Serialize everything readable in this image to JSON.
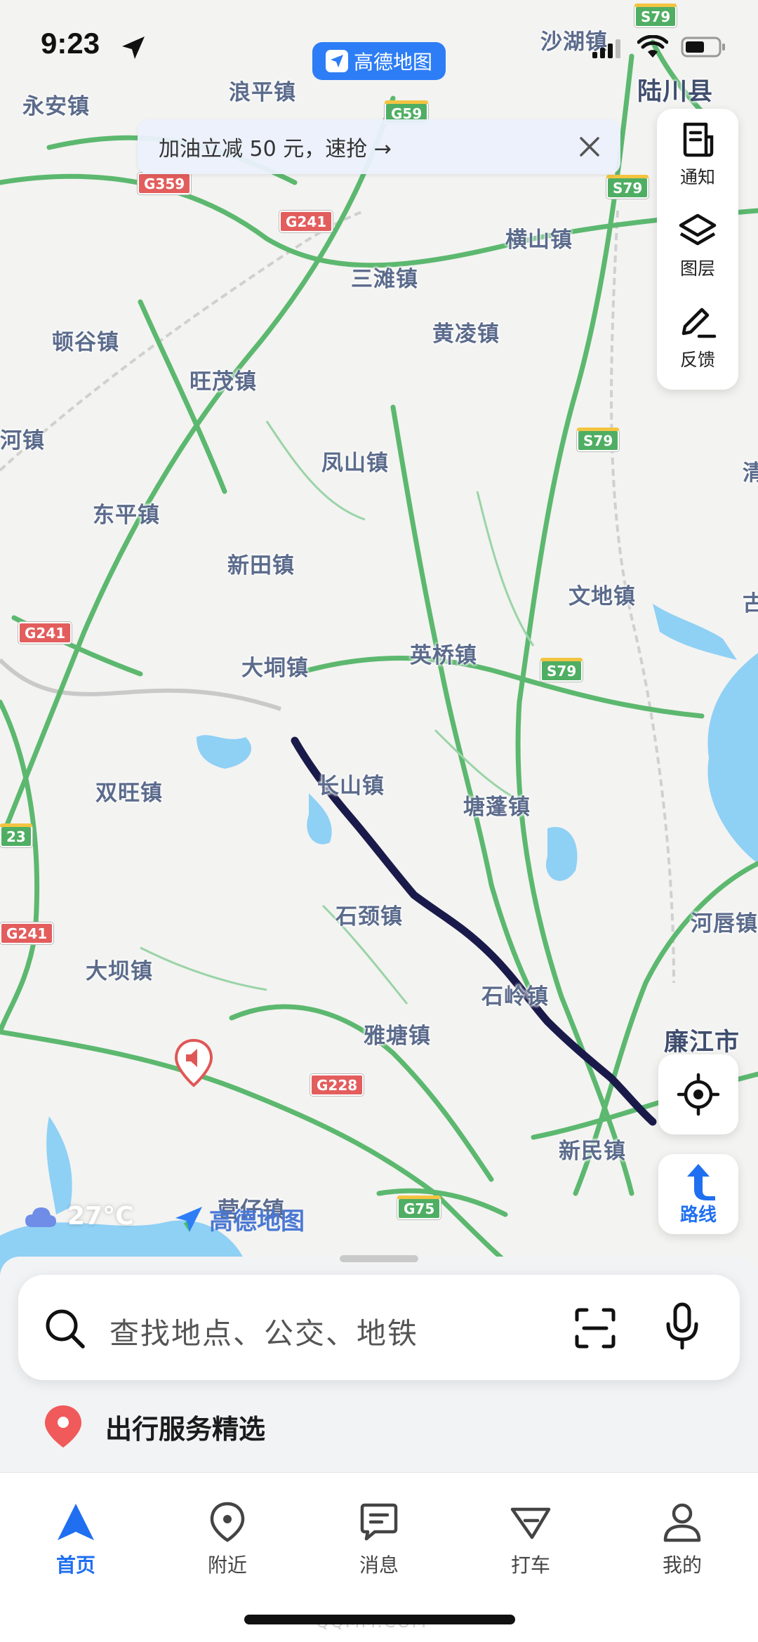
{
  "status_bar": {
    "time": "9:23"
  },
  "app_pill": {
    "label": "高德地图"
  },
  "promo": {
    "text": "加油立减 50 元，速抢 →"
  },
  "side_panel": {
    "items": [
      {
        "label": "通知"
      },
      {
        "label": "图层"
      },
      {
        "label": "反馈"
      }
    ]
  },
  "map": {
    "places": [
      {
        "name": "沙湖镇"
      },
      {
        "name": "陆川县"
      },
      {
        "name": "永安镇"
      },
      {
        "name": "浪平镇"
      },
      {
        "name": "横山镇"
      },
      {
        "name": "三滩镇"
      },
      {
        "name": "顿谷镇"
      },
      {
        "name": "黄凌镇"
      },
      {
        "name": "旺茂镇"
      },
      {
        "name": "河镇"
      },
      {
        "name": "凤山镇"
      },
      {
        "name": "东平镇"
      },
      {
        "name": "新田镇"
      },
      {
        "name": "文地镇"
      },
      {
        "name": "大垌镇"
      },
      {
        "name": "英桥镇"
      },
      {
        "name": "长山镇"
      },
      {
        "name": "双旺镇"
      },
      {
        "name": "塘蓬镇"
      },
      {
        "name": "石颈镇"
      },
      {
        "name": "河唇镇"
      },
      {
        "name": "大坝镇"
      },
      {
        "name": "石岭镇"
      },
      {
        "name": "雅塘镇"
      },
      {
        "name": "廉江市"
      },
      {
        "name": "新民镇"
      },
      {
        "name": "营仔镇"
      },
      {
        "name": "清"
      },
      {
        "name": "古"
      }
    ],
    "shields": [
      {
        "code": "S79"
      },
      {
        "code": "G59"
      },
      {
        "code": "G359"
      },
      {
        "code": "S79"
      },
      {
        "code": "G241"
      },
      {
        "code": "S79"
      },
      {
        "code": "G241"
      },
      {
        "code": "S79"
      },
      {
        "code": "23"
      },
      {
        "code": "G241"
      },
      {
        "code": "G228"
      },
      {
        "code": "G75"
      }
    ]
  },
  "weather": {
    "temp": "27°C"
  },
  "watermark": {
    "text": "高德地图"
  },
  "route_button": {
    "label": "路线"
  },
  "search": {
    "placeholder": "查找地点、公交、地铁"
  },
  "services": {
    "title": "出行服务精选"
  },
  "tabs": [
    {
      "label": "首页"
    },
    {
      "label": "附近"
    },
    {
      "label": "消息"
    },
    {
      "label": "打车"
    },
    {
      "label": "我的"
    }
  ],
  "footer_watermark": "QQMM.COM",
  "colors": {
    "accent": "#2d7df6",
    "road_green": "#4fae63",
    "route_line": "#1a1a4a",
    "water": "#8fd0f5"
  }
}
